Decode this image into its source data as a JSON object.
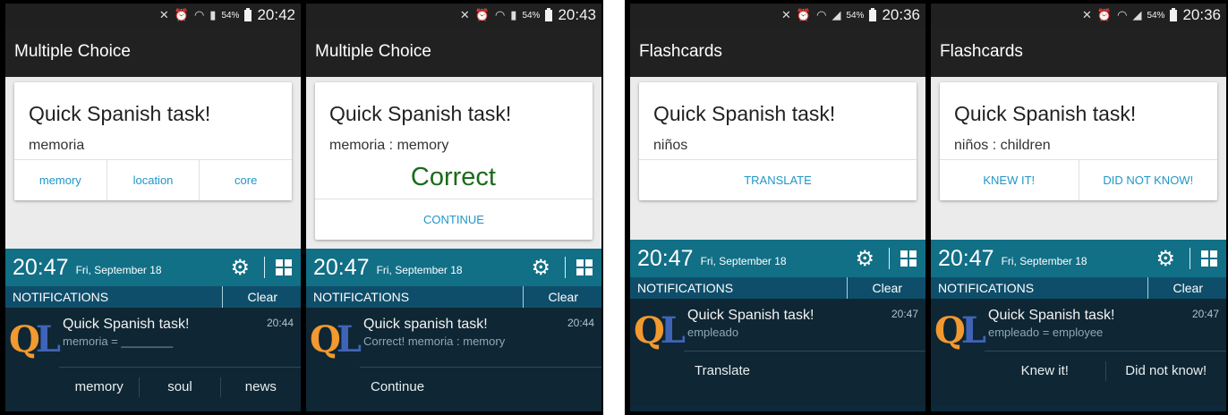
{
  "colors": {
    "appbar": "#212121",
    "status": "#202020",
    "accent": "#2196c9",
    "correct": "#1b6b1b",
    "shade_header": "#116f86",
    "notif_bg": "#0f2634"
  },
  "screens": [
    {
      "status_battery": "54%",
      "status_time": "20:42",
      "title": "Multiple Choice",
      "card": {
        "heading": "Quick Spanish task!",
        "word": "memoria",
        "result": "",
        "buttons": [
          "memory",
          "location",
          "core"
        ]
      },
      "shade": {
        "time": "20:47",
        "date": "Fri, September 18",
        "section": "NOTIFICATIONS",
        "clear": "Clear"
      },
      "notification": {
        "title": "Quick Spanish task!",
        "text": "memoria = ________",
        "time": "20:44",
        "actions": [
          "memory",
          "soul",
          "news"
        ]
      }
    },
    {
      "status_battery": "54%",
      "status_time": "20:43",
      "title": "Multiple Choice",
      "card": {
        "heading": "Quick Spanish task!",
        "word": "memoria : memory",
        "result": "Correct",
        "buttons": [
          "CONTINUE"
        ]
      },
      "shade": {
        "time": "20:47",
        "date": "Fri, September 18",
        "section": "NOTIFICATIONS",
        "clear": "Clear"
      },
      "notification": {
        "title": "Quick spanish task!",
        "text": "Correct! memoria : memory",
        "time": "20:44",
        "actions": [
          "Continue"
        ]
      }
    },
    {
      "status_battery": "54%",
      "status_time": "20:36",
      "title": "Flashcards",
      "card": {
        "heading": "Quick Spanish task!",
        "word": "niños",
        "result": "",
        "buttons": [
          "TRANSLATE"
        ]
      },
      "shade": {
        "time": "20:47",
        "date": "Fri, September 18",
        "section": "NOTIFICATIONS",
        "clear": "Clear"
      },
      "notification": {
        "title": "Quick Spanish task!",
        "text": "empleado",
        "time": "20:47",
        "actions": [
          "Translate"
        ]
      }
    },
    {
      "status_battery": "54%",
      "status_time": "20:36",
      "title": "Flashcards",
      "card": {
        "heading": "Quick Spanish task!",
        "word": "niños : children",
        "result": "",
        "buttons": [
          "KNEW IT!",
          "DID NOT KNOW!"
        ]
      },
      "shade": {
        "time": "20:47",
        "date": "Fri, September 18",
        "section": "NOTIFICATIONS",
        "clear": "Clear"
      },
      "notification": {
        "title": "Quick Spanish task!",
        "text": "empleado = employee",
        "time": "20:47",
        "actions": [
          "Knew it!",
          "Did not know!"
        ]
      }
    }
  ]
}
